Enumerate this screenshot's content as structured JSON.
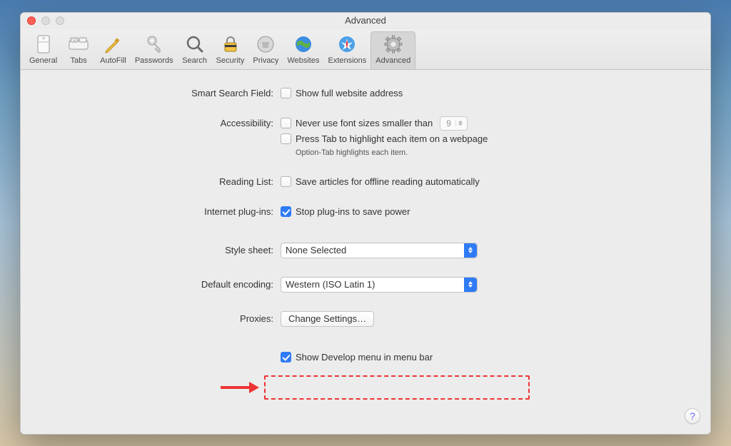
{
  "window": {
    "title": "Advanced"
  },
  "toolbar": {
    "items": [
      {
        "label": "General"
      },
      {
        "label": "Tabs"
      },
      {
        "label": "AutoFill"
      },
      {
        "label": "Passwords"
      },
      {
        "label": "Search"
      },
      {
        "label": "Security"
      },
      {
        "label": "Privacy"
      },
      {
        "label": "Websites"
      },
      {
        "label": "Extensions"
      },
      {
        "label": "Advanced"
      }
    ]
  },
  "labels": {
    "smartSearch": "Smart Search Field:",
    "accessibility": "Accessibility:",
    "readingList": "Reading List:",
    "plugins": "Internet plug-ins:",
    "styleSheet": "Style sheet:",
    "defaultEncoding": "Default encoding:",
    "proxies": "Proxies:"
  },
  "options": {
    "showFullAddress": "Show full website address",
    "neverUseFont": "Never use font sizes smaller than",
    "fontSizeValue": "9",
    "pressTab": "Press Tab to highlight each item on a webpage",
    "optionTabNote": "Option-Tab highlights each item.",
    "saveArticles": "Save articles for offline reading automatically",
    "stopPlugins": "Stop plug-ins to save power",
    "styleSheetValue": "None Selected",
    "encodingValue": "Western (ISO Latin 1)",
    "changeSettings": "Change Settings…",
    "showDevelop": "Show Develop menu in menu bar"
  },
  "help": "?"
}
